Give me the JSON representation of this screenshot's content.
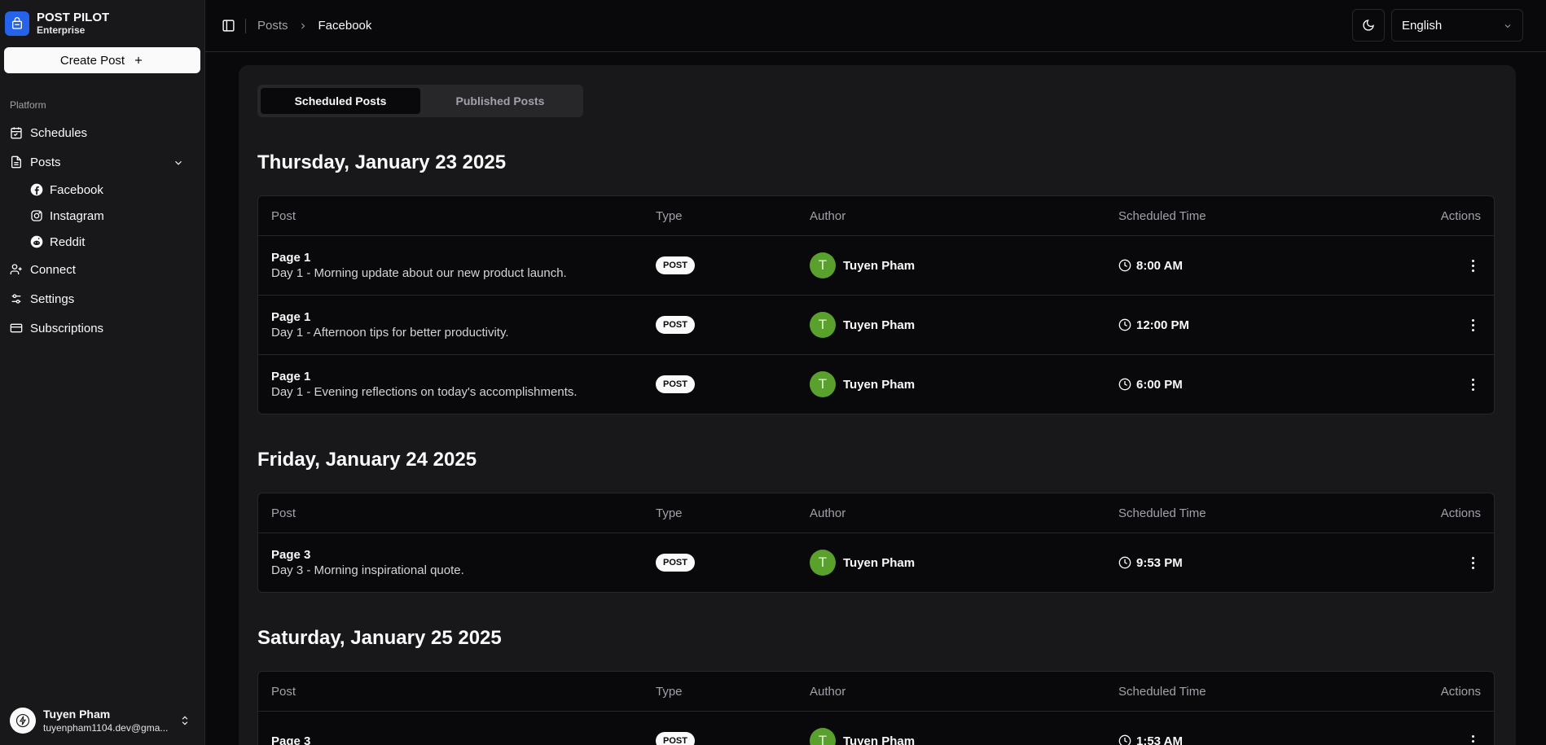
{
  "app": {
    "name": "POST PILOT",
    "plan": "Enterprise",
    "create_label": "Create Post"
  },
  "sidebar": {
    "group_label": "Platform",
    "items": [
      {
        "label": "Schedules",
        "icon": "calendar-icon"
      },
      {
        "label": "Posts",
        "icon": "file-text-icon"
      },
      {
        "label": "Connect",
        "icon": "user-plus-icon"
      },
      {
        "label": "Settings",
        "icon": "settings-sliders-icon"
      },
      {
        "label": "Subscriptions",
        "icon": "credit-card-icon"
      }
    ],
    "posts_sub": [
      {
        "label": "Facebook",
        "icon": "facebook-icon"
      },
      {
        "label": "Instagram",
        "icon": "instagram-icon"
      },
      {
        "label": "Reddit",
        "icon": "reddit-icon"
      }
    ]
  },
  "user": {
    "name": "Tuyen Pham",
    "email": "tuyenpham1104.dev@gma..."
  },
  "header": {
    "breadcrumb": [
      "Posts",
      "Facebook"
    ],
    "language": "English"
  },
  "tabs": {
    "scheduled": "Scheduled Posts",
    "published": "Published Posts"
  },
  "columns": {
    "post": "Post",
    "type": "Type",
    "author": "Author",
    "time": "Scheduled Time",
    "actions": "Actions"
  },
  "days": [
    {
      "title": "Thursday, January 23 2025",
      "rows": [
        {
          "page": "Page 1",
          "desc": "Day 1 - Morning update about our new product launch.",
          "type": "POST",
          "initial": "T",
          "author": "Tuyen Pham",
          "time": "8:00 AM"
        },
        {
          "page": "Page 1",
          "desc": "Day 1 - Afternoon tips for better productivity.",
          "type": "POST",
          "initial": "T",
          "author": "Tuyen Pham",
          "time": "12:00 PM"
        },
        {
          "page": "Page 1",
          "desc": "Day 1 - Evening reflections on today's accomplishments.",
          "type": "POST",
          "initial": "T",
          "author": "Tuyen Pham",
          "time": "6:00 PM"
        }
      ]
    },
    {
      "title": "Friday, January 24 2025",
      "rows": [
        {
          "page": "Page 3",
          "desc": "Day 3 - Morning inspirational quote.",
          "type": "POST",
          "initial": "T",
          "author": "Tuyen Pham",
          "time": "9:53 PM"
        }
      ]
    },
    {
      "title": "Saturday, January 25 2025",
      "rows": [
        {
          "page": "Page 3",
          "desc": "",
          "type": "POST",
          "initial": "T",
          "author": "Tuyen Pham",
          "time": "1:53 AM"
        }
      ]
    }
  ],
  "colors": {
    "accent": "#2563eb",
    "avatar_green": "#5aa02c",
    "background": "#09090b",
    "sidebar": "#18181b"
  }
}
